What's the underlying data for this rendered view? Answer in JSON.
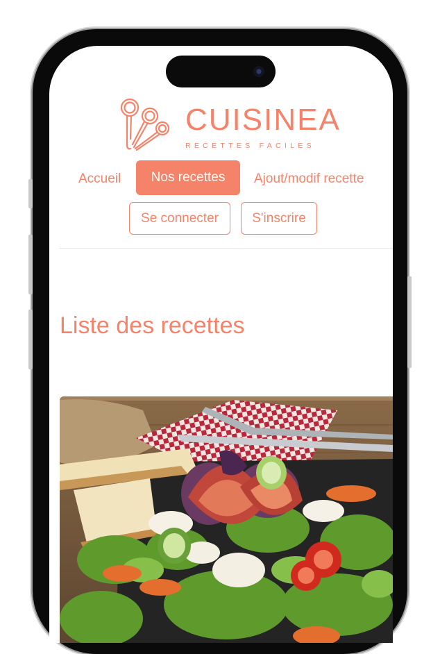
{
  "header": {
    "brand": "CUISINEA",
    "tagline": "RECETTES FACILES"
  },
  "nav": {
    "home": "Accueil",
    "recipes": "Nos recettes",
    "edit": "Ajout/modif recette",
    "login": "Se connecter",
    "signup": "S'inscrire"
  },
  "main": {
    "title": "Liste des recettes"
  },
  "colors": {
    "accent": "#f58369"
  }
}
